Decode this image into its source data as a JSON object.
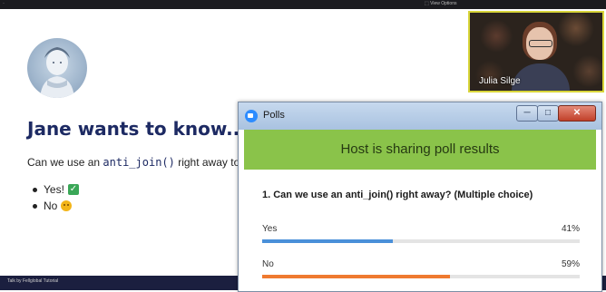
{
  "top_bar": {
    "left_text": "·",
    "right_text": "⬚ View Options"
  },
  "slide": {
    "title": "Jane wants to know...",
    "question_prefix": "Can we use an ",
    "question_code": "anti_join()",
    "question_suffix": " right away to re",
    "bullets": [
      {
        "label": "Yes!",
        "icon": "check-mark-icon"
      },
      {
        "label": "No",
        "icon": "smiling-face-icon"
      }
    ],
    "footer_text": "Talk by Fellglobal Tutorial",
    "portrait_icon": "portrait-icon"
  },
  "video": {
    "participant_name": "Julia Silge",
    "border_color": "#d8d53a"
  },
  "poll_window": {
    "title": "Polls",
    "banner_text": "Host is sharing poll results",
    "question": "1. Can we use an anti_join() right away? (Multiple choice)",
    "options": [
      {
        "label": "Yes",
        "percent_label": "41%",
        "percent": 41,
        "color": "#4a90d9"
      },
      {
        "label": "No",
        "percent_label": "59%",
        "percent": 59,
        "color": "#ef7a30"
      }
    ],
    "window_buttons": {
      "minimize": "─",
      "maximize": "□",
      "close": "✕"
    },
    "banner_color": "#8ac34a"
  },
  "colors": {
    "title_navy": "#1d2a63",
    "footer_navy": "#1b1f3f"
  }
}
